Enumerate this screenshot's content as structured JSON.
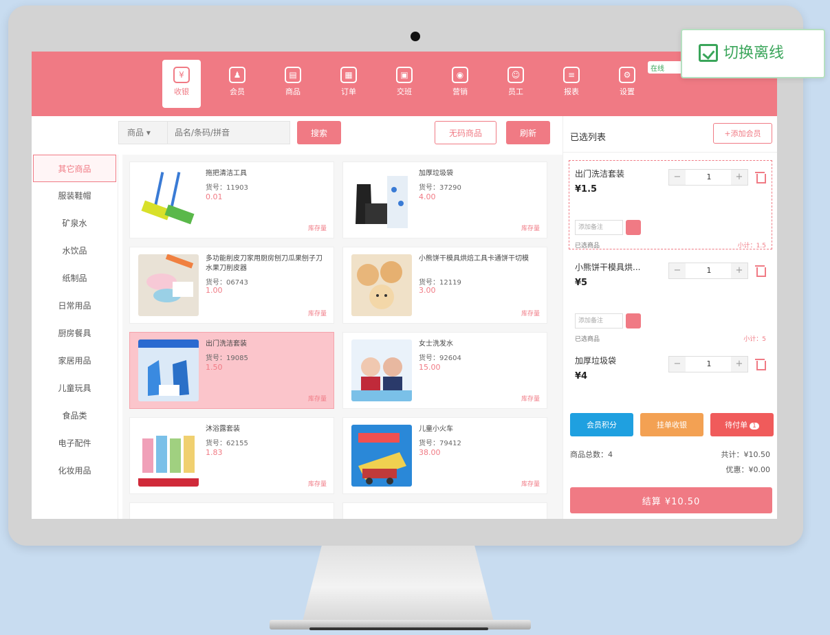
{
  "colors": {
    "accent": "#f07a84",
    "green": "#3aa55a",
    "blue": "#1fa0e0",
    "orange": "#f3a153",
    "red": "#f05b5b"
  },
  "switch_label": "切换离线",
  "offline_tag": "在线",
  "nav": [
    {
      "label": "收银",
      "icon": "cashier-icon",
      "glyph": "¥",
      "active": true
    },
    {
      "label": "会员",
      "icon": "member-icon",
      "glyph": "♟",
      "active": false
    },
    {
      "label": "商品",
      "icon": "goods-icon",
      "glyph": "▤",
      "active": false
    },
    {
      "label": "订单",
      "icon": "order-icon",
      "glyph": "▦",
      "active": false
    },
    {
      "label": "交班",
      "icon": "shift-icon",
      "glyph": "▣",
      "active": false
    },
    {
      "label": "营销",
      "icon": "marketing-icon",
      "glyph": "◉",
      "active": false
    },
    {
      "label": "员工",
      "icon": "staff-icon",
      "glyph": "☺",
      "active": false
    },
    {
      "label": "报表",
      "icon": "report-icon",
      "glyph": "≡",
      "active": false
    },
    {
      "label": "设置",
      "icon": "settings-icon",
      "glyph": "⚙",
      "active": false
    }
  ],
  "toolbar": {
    "type_select": "商品 ▾",
    "search_placeholder": "品名/条码/拼音",
    "search_btn": "搜索",
    "unknown_btn": "无码商品",
    "refresh_btn": "刷新"
  },
  "categories": [
    "其它商品",
    "服装鞋帽",
    "矿泉水",
    "水饮品",
    "纸制品",
    "日常用品",
    "厨房餐具",
    "家居用品",
    "儿童玩具",
    "食品类",
    "电子配件",
    "化妆用品"
  ],
  "active_category": 0,
  "products": [
    {
      "name": "拖把清洁工具",
      "code": "货号：11903",
      "price": "0.01",
      "stock": "库存量",
      "selected": false,
      "img": "mop"
    },
    {
      "name": "加厚垃圾袋",
      "code": "货号：37290",
      "price": "4.00",
      "stock": "库存量",
      "selected": false,
      "img": "bags"
    },
    {
      "name": "多功能削皮刀家用厨房刨刀瓜果刨子刀水果刀削皮器",
      "code": "货号：06743",
      "price": "1.00",
      "stock": "库存量",
      "selected": false,
      "img": "peeler"
    },
    {
      "name": "小熊饼干模具烘焙工具卡通饼干切模",
      "code": "货号：12119",
      "price": "3.00",
      "stock": "库存量",
      "selected": false,
      "img": "cookies"
    },
    {
      "name": "出门洗洁套装",
      "code": "货号：19085",
      "price": "1.50",
      "stock": "库存量",
      "selected": true,
      "img": "detergent"
    },
    {
      "name": "女士洗发水",
      "code": "货号：92604",
      "price": "15.00",
      "stock": "库存量",
      "selected": false,
      "img": "shampoo"
    },
    {
      "name": "沐浴露套装",
      "code": "货号：62155",
      "price": "1.83",
      "stock": "库存量",
      "selected": false,
      "img": "bodywash"
    },
    {
      "name": "儿童小火车",
      "code": "货号：79412",
      "price": "38.00",
      "stock": "库存量",
      "selected": false,
      "img": "train"
    }
  ],
  "cart": {
    "title": "已选列表",
    "add_member": "+添加会员",
    "items": [
      {
        "name": "出门洗洁套装",
        "price": "¥1.5",
        "qty": "1",
        "remark_placeholder": "添加备注",
        "note": "已选商品",
        "subtotal": "小计：1.5",
        "active": true
      },
      {
        "name": "小熊饼干模具烘...",
        "price": "¥5",
        "qty": "1",
        "remark_placeholder": "添加备注",
        "note": "已选商品",
        "subtotal": "小计：5",
        "active": false
      },
      {
        "name": "加厚垃圾袋",
        "price": "¥4",
        "qty": "1",
        "active": false
      }
    ],
    "btn_coupon": "会员积分",
    "btn_hold": "挂单收银",
    "btn_pending": "待付单",
    "pending_count": "1",
    "count_label": "商品总数：4",
    "total_label": "共计：¥10.50",
    "discount_label": "优惠：¥0.00",
    "checkout": "结算  ¥10.50"
  }
}
